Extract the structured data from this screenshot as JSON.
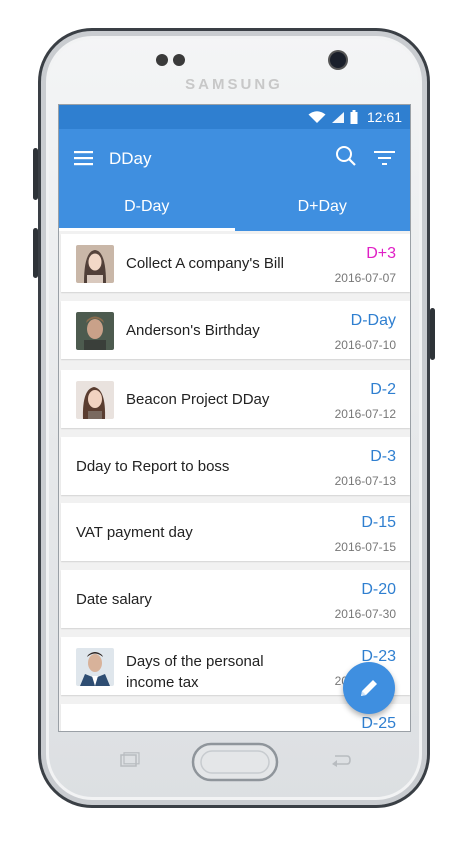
{
  "device": {
    "brand": "SAMSUNG"
  },
  "status_bar": {
    "time": "12:61",
    "icons": [
      "wifi-icon",
      "signal-icon",
      "battery-icon"
    ]
  },
  "app_bar": {
    "title": "DDay",
    "icons": [
      "menu-icon",
      "search-icon",
      "filter-icon"
    ]
  },
  "tabs": [
    {
      "label": "D-Day",
      "selected": true
    },
    {
      "label": "D+Day",
      "selected": false
    }
  ],
  "items": [
    {
      "title": "Collect A company's Bill",
      "dday": "D+3",
      "date": "2016-07-07",
      "has_avatar": true,
      "accent": "#e020c6"
    },
    {
      "title": "Anderson's Birthday",
      "dday": "D-Day",
      "date": "2016-07-10",
      "has_avatar": true,
      "accent": "#2f7fd0"
    },
    {
      "title": "Beacon Project DDay",
      "dday": "D-2",
      "date": "2016-07-12",
      "has_avatar": true,
      "accent": "#2f7fd0"
    },
    {
      "title": "Dday to Report to boss",
      "dday": "D-3",
      "date": "2016-07-13",
      "has_avatar": false,
      "accent": "#2f7fd0"
    },
    {
      "title": "VAT payment day",
      "dday": "D-15",
      "date": "2016-07-15",
      "has_avatar": false,
      "accent": "#2f7fd0"
    },
    {
      "title": "Date salary",
      "dday": "D-20",
      "date": "2016-07-30",
      "has_avatar": false,
      "accent": "#2f7fd0"
    },
    {
      "title": "Days of the personal income tax",
      "title_line1": "Days of the personal",
      "title_line2": "income tax",
      "dday": "D-23",
      "date": "20",
      "has_avatar": true,
      "accent": "#2f7fd0"
    },
    {
      "title": "",
      "dday": "D-25",
      "date": "",
      "has_avatar": false,
      "accent": "#2f7fd0"
    }
  ],
  "fab": {
    "icon": "pencil-icon"
  },
  "colors": {
    "primary": "#3f8fe0",
    "status_bar": "#2f7fd0",
    "accent_pink": "#e020c6"
  }
}
